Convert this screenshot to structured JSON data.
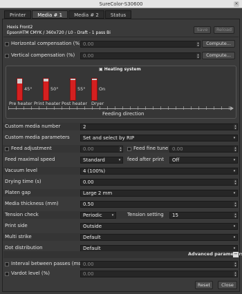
{
  "window": {
    "title": "SureColor-S30600",
    "close_glyph": "×"
  },
  "tabs": [
    {
      "label": "Printer"
    },
    {
      "label": "Media # 1"
    },
    {
      "label": "Media # 2"
    },
    {
      "label": "Status"
    }
  ],
  "media_header": {
    "line1": "Hexis Front2",
    "line2": "EpsonHTM CMYK / 360x720 / L0 - Draft - 1 pass Bi",
    "save_label": "Save",
    "reload_label": "Reload"
  },
  "compensation": {
    "horizontal_label": "Horizontal compensation (%)",
    "horizontal_value": "0.00",
    "vertical_label": "Vertical compensation (%)",
    "vertical_value": "0.00",
    "compute_label": "Compute..."
  },
  "heating": {
    "title": "Heating system",
    "heaters": [
      {
        "name": "Pre heater",
        "temp": "45°",
        "level": 0.78
      },
      {
        "name": "Print heater",
        "temp": "50°",
        "level": 0.86
      },
      {
        "name": "Post heater",
        "temp": "55°",
        "level": 0.94
      },
      {
        "name": "Dryer",
        "temp": "On",
        "level": 0.95
      }
    ],
    "feeding_label": "Feeding direction"
  },
  "settings": {
    "custom_media_number_label": "Custom media number",
    "custom_media_number_value": "2",
    "custom_media_params_label": "Custom media parameters",
    "custom_media_params_value": "Set and select by RIP",
    "feed_adjustment_label": "Feed adjustment",
    "feed_adjustment_value": "0.00",
    "feed_fine_tune_label": "Feed fine tune",
    "feed_fine_tune_value": "0.00",
    "feed_max_speed_label": "Feed maximal speed",
    "feed_max_speed_value": "Standard",
    "feed_after_print_label": "feed after print",
    "feed_after_print_value": "Off",
    "vacuum_label": "Vacuum level",
    "vacuum_value": "4 (100%)",
    "drying_label": "Drying time (s)",
    "drying_value": "0.00",
    "platen_label": "Platen gap",
    "platen_value": "Large 2 mm",
    "thickness_label": "Media thickness (mm)",
    "thickness_value": "0.50",
    "tension_check_label": "Tension check",
    "tension_check_value": "Periodic",
    "tension_setting_label": "Tension setting",
    "tension_setting_value": "15",
    "print_side_label": "Print side",
    "print_side_value": "Outside",
    "multi_strike_label": "Multi strike",
    "multi_strike_value": "Default",
    "dot_distribution_label": "Dot distribution",
    "dot_distribution_value": "Default"
  },
  "advanced": {
    "title": "Advanced parameters",
    "toggle_glyph": "−",
    "interval_label": "Interval between passes (ms)",
    "interval_value": "0.00",
    "vardot_label": "Vardot level (%)",
    "vardot_value": "0.00"
  },
  "footer": {
    "reset_label": "Reset",
    "close_label": "Close"
  },
  "colors": {
    "heater_fill": "#d42020",
    "accent": "#474747"
  }
}
